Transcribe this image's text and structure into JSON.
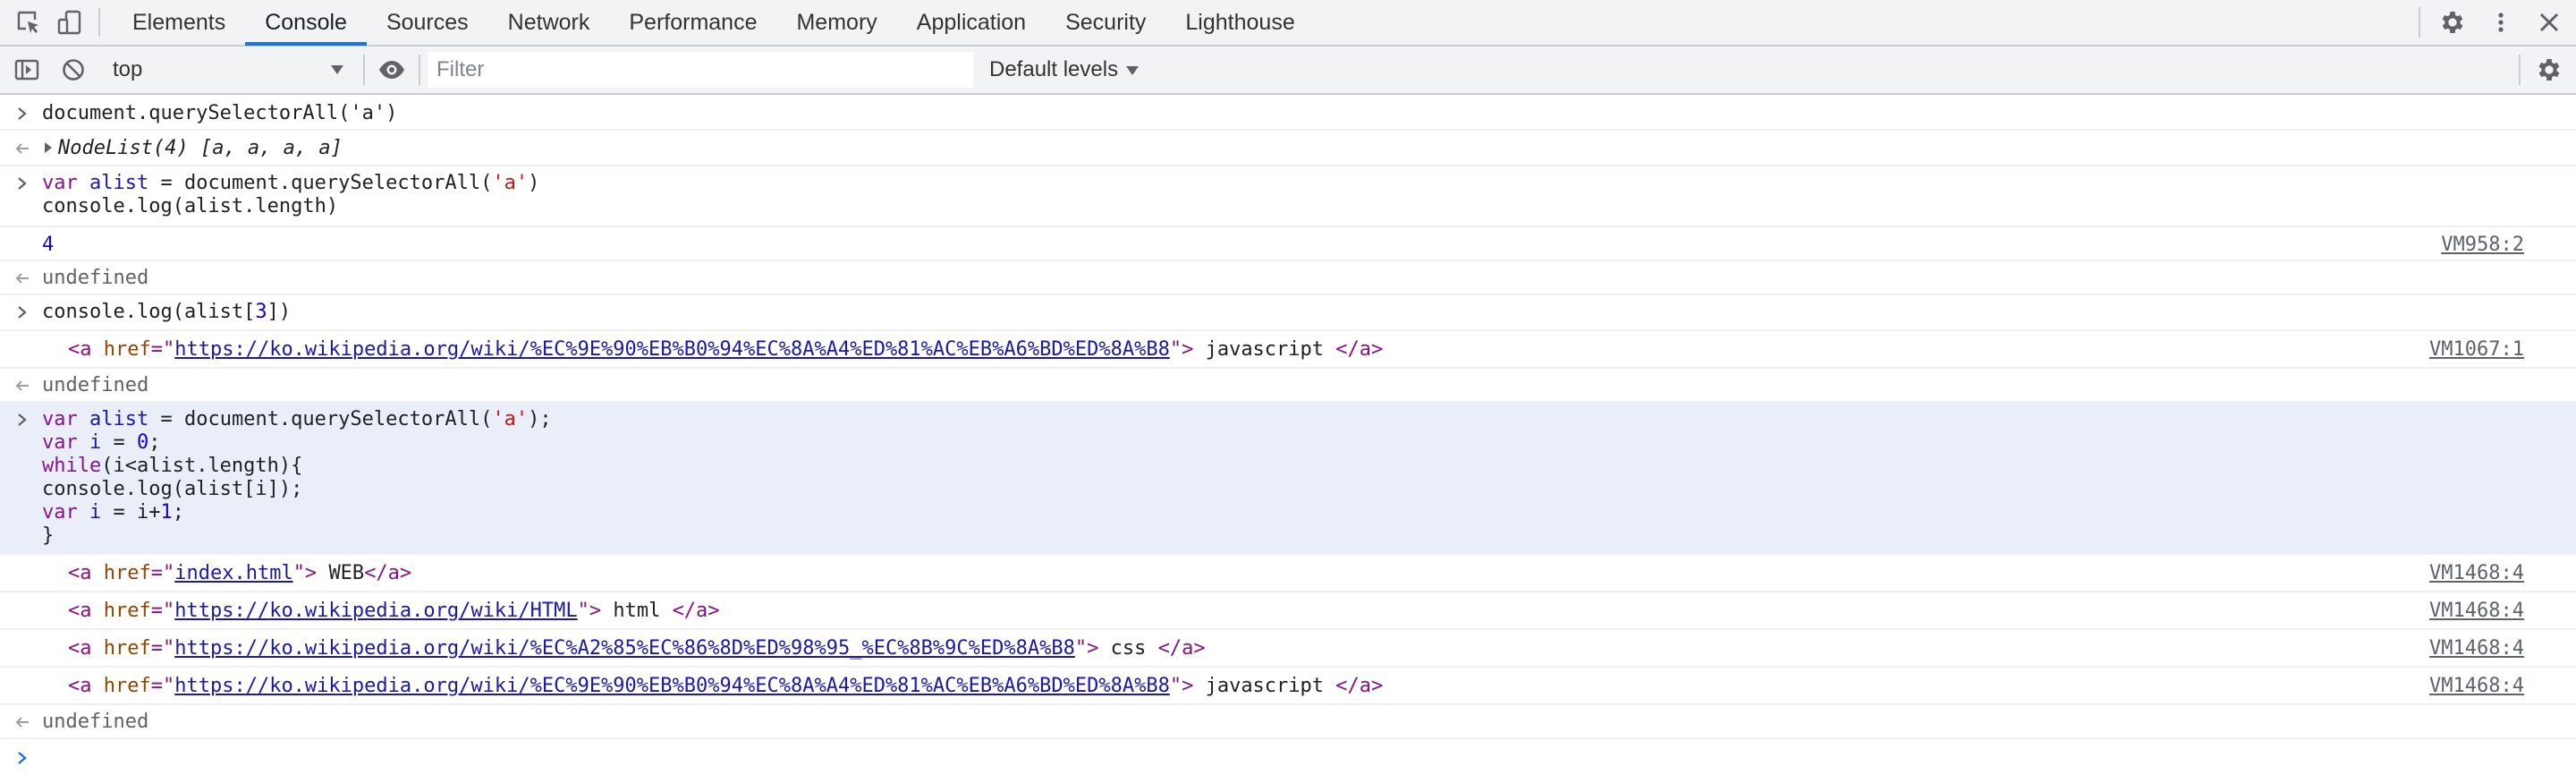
{
  "tabs": [
    "Elements",
    "Console",
    "Sources",
    "Network",
    "Performance",
    "Memory",
    "Application",
    "Security",
    "Lighthouse"
  ],
  "active_tab": "Console",
  "toolbar": {
    "context": "top",
    "filter_placeholder": "Filter",
    "levels": "Default levels"
  },
  "console": {
    "m1": "document.querySelectorAll('a')",
    "m2": {
      "label": "NodeList(4)",
      "items": "[a, a, a, a]"
    },
    "m3": {
      "l1": {
        "kw": "var",
        "name": "alist",
        "rest": "= document.querySelectorAll(",
        "str": "'a'",
        "end": ")"
      },
      "l2": "console.log(alist.length)"
    },
    "m4": {
      "value": "4",
      "source": "VM958:2"
    },
    "m5": "undefined",
    "m6": {
      "pre": "console.log(alist[",
      "num": "3",
      "post": "])"
    },
    "m7": {
      "href": "https://ko.wikipedia.org/wiki/%EC%9E%90%EB%B0%94%EC%8A%A4%ED%81%AC%EB%A6%BD%ED%8A%B8",
      "text": "javascript",
      "source": "VM1067:1"
    },
    "m8": "undefined",
    "m9": {
      "l1": {
        "kw": "var",
        "name": "alist",
        "rest": "= document.querySelectorAll(",
        "str": "'a'",
        "end": ");"
      },
      "l2": {
        "kw": "var",
        "name": "i",
        "eq": "=",
        "num": "0",
        "end": ";"
      },
      "l3": {
        "kw": "while",
        "rest": "(i<alist.length){"
      },
      "l4": "console.log(alist[i]);",
      "l5": {
        "kw": "var",
        "name": "i",
        "eq": "=",
        "rest": "i+",
        "num": "1",
        "end": ";"
      },
      "l6": "}"
    },
    "logs": [
      {
        "href": "index.html",
        "text": "WEB",
        "source": "VM1468:4"
      },
      {
        "href": "https://ko.wikipedia.org/wiki/HTML",
        "text": "html",
        "source": "VM1468:4"
      },
      {
        "href": "https://ko.wikipedia.org/wiki/%EC%A2%85%EC%86%8D%ED%98%95_%EC%8B%9C%ED%8A%B8",
        "text": "css",
        "source": "VM1468:4"
      },
      {
        "href": "https://ko.wikipedia.org/wiki/%EC%9E%90%EB%B0%94%EC%8A%A4%ED%81%AC%EB%A6%BD%ED%8A%B8",
        "text": "javascript",
        "source": "VM1468:4"
      }
    ],
    "m15": "undefined"
  },
  "colors": {
    "accent": "#1a73e8",
    "highlight_row": "#eaeef8",
    "keyword": "#881391",
    "string": "#c41a16",
    "number": "#1c00cf"
  },
  "icons": [
    "inspect-element-icon",
    "device-toolbar-icon",
    "settings-icon",
    "more-options-icon",
    "close-icon",
    "sidebar-toggle-icon",
    "clear-console-icon",
    "dropdown-caret-icon",
    "live-expression-eye-icon",
    "console-settings-icon",
    "input-chevron-icon",
    "result-arrow-icon",
    "expand-triangle-icon"
  ]
}
